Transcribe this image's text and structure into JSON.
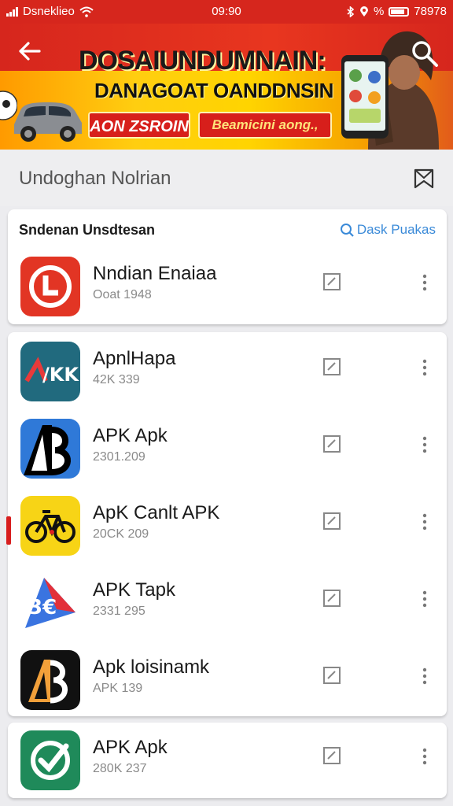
{
  "status_bar": {
    "carrier": "Dsneklieo",
    "time": "09:90",
    "right_text": "% ",
    "right_number": "78978"
  },
  "banner": {
    "headline": "DOSAIUNDUMNAIN:",
    "subheadline": "DANAGOAT OANDDNSIN",
    "button_a": "AON ZSROIN",
    "button_b": "Beamicini aong.,"
  },
  "section": {
    "title": "Undoghan Nolrian"
  },
  "card": {
    "title": "Sndenan Unsdtesan",
    "link": "Dask Puakas"
  },
  "apps": [
    {
      "name": "Nndian Enaiaa",
      "meta": "Ooat 1948",
      "icon": "red-circle-logo"
    },
    {
      "name": "ApnlHapa",
      "meta": "42K 339",
      "icon": "apk-teal-logo"
    },
    {
      "name": "APK Apk",
      "meta": "2301.209",
      "icon": "ap-blue-logo"
    },
    {
      "name": "ApK Canlt APK",
      "meta": "20CK 209",
      "icon": "bicycle-logo"
    },
    {
      "name": "APK Tapk",
      "meta": "2331 295",
      "icon": "arrow-blue-logo"
    },
    {
      "name": "Apk loisinamk",
      "meta": "APK 139",
      "icon": "ap-black-logo"
    },
    {
      "name": "APK Apk",
      "meta": "280K 237",
      "icon": "check-green-logo"
    }
  ],
  "colors": {
    "brand_red": "#d6261d",
    "link_blue": "#3a8ad8",
    "background": "#ececef"
  }
}
